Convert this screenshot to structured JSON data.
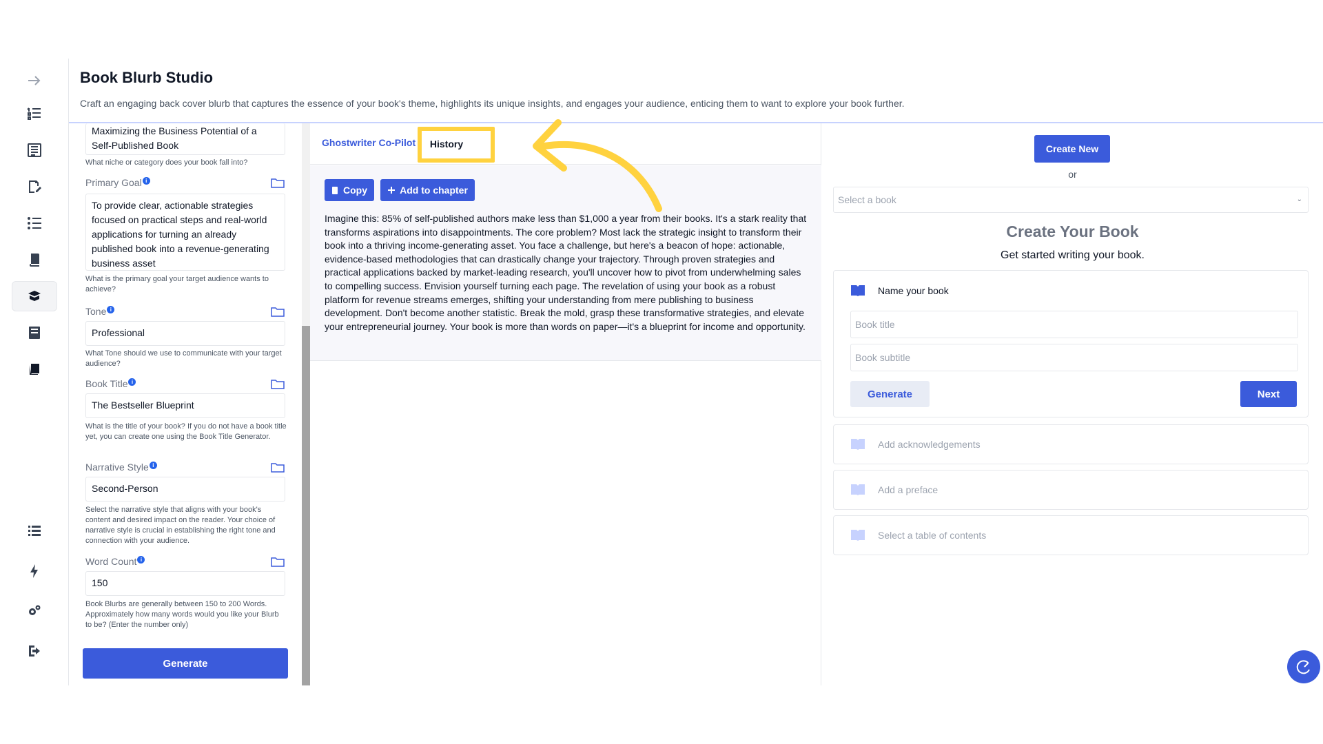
{
  "header": {
    "title": "Book Blurb Studio",
    "description": "Craft an engaging back cover blurb that captures the essence of your book's theme, highlights its unique insights, and engages your audience, enticing them to want to explore your book further."
  },
  "sidebar": {
    "icons": [
      "arrow-right-icon",
      "list-outline-icon",
      "book-list-icon",
      "edit-document-icon",
      "checklist-icon",
      "book-stack-icon",
      "books-icon",
      "bookshelf-icon",
      "book-icon",
      "list-icon",
      "lightning-icon",
      "gears-icon",
      "logout-icon"
    ],
    "active_index": 6
  },
  "form": {
    "niche_value": "Maximizing the Business Potential of a Self-Published Book",
    "niche_hint": "What niche or category does your book fall into?",
    "primary_goal": {
      "label": "Primary Goal",
      "value": "To provide clear, actionable strategies focused on practical steps and real-world applications for turning an already published book into a revenue-generating business asset",
      "hint": "What is the primary goal your target audience wants to achieve?"
    },
    "tone": {
      "label": "Tone",
      "value": "Professional",
      "hint": "What Tone should we use to communicate with your target audience?"
    },
    "book_title": {
      "label": "Book Title",
      "value": "The Bestseller Blueprint",
      "hint": "What is the title of your book? If you do not have a book title yet, you can create one using the Book Title Generator."
    },
    "narrative_style": {
      "label": "Narrative Style",
      "value": "Second-Person",
      "hint": "Select the narrative style that aligns with your book's content and desired impact on the reader. Your choice of narrative style is crucial in establishing the right tone and connection with your audience."
    },
    "word_count": {
      "label": "Word Count",
      "value": "150",
      "hint": "Book Blurbs are generally between 150 to 200 Words. Approximately how many words would you like your Blurb to be? (Enter the number only)"
    },
    "generate_label": "Generate"
  },
  "middle": {
    "tabs": [
      {
        "label": "Ghostwriter Co-Pilot"
      },
      {
        "label": "History"
      }
    ],
    "copy_label": "Copy",
    "add_chapter_label": "Add to chapter",
    "output": "Imagine this: 85% of self-published authors make less than $1,000 a year from their books. It's a stark reality that transforms aspirations into disappointments. The core problem? Most lack the strategic insight to transform their book into a thriving income-generating asset. You face a challenge, but here's a beacon of hope: actionable, evidence-based methodologies that can drastically change your trajectory. Through proven strategies and practical applications backed by market-leading research, you'll uncover how to pivot from underwhelming sales to compelling success. Envision yourself turning each page. The revelation of using your book as a robust platform for revenue streams emerges, shifting your understanding from mere publishing to business development. Don't become another statistic. Break the mold, grasp these transformative strategies, and elevate your entrepreneurial journey. Your book is more than words on paper—it's a blueprint for income and opportunity."
  },
  "right": {
    "create_new_label": "Create New",
    "or_label": "or",
    "select_placeholder": "Select a book",
    "create_title": "Create Your Book",
    "create_subtitle": "Get started writing your book.",
    "name_heading": "Name your book",
    "title_placeholder": "Book title",
    "subtitle_placeholder": "Book subtitle",
    "generate_label": "Generate",
    "next_label": "Next",
    "steps": [
      {
        "label": "Add acknowledgements"
      },
      {
        "label": "Add a preface"
      },
      {
        "label": "Select a table of contents"
      }
    ]
  },
  "colors": {
    "accent": "#3b5bdb",
    "highlight": "#ffd23f"
  }
}
